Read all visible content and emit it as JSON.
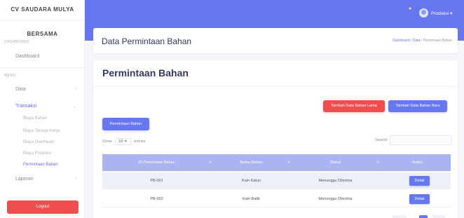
{
  "sidebar": {
    "brand_line1": "CV SAUDARA MULYA",
    "brand_line2": "BERSAMA",
    "section_dashboard": "DASHBOARD",
    "dashboard_label": "Dashboard",
    "section_menu": "MENU",
    "data_label": "Data",
    "transaksi_label": "Transaksi",
    "transaksi_items": [
      "Biaya Bahan",
      "Biaya Tenaga Kerja",
      "Biaya Overhead",
      "Biaya Produksi",
      "Permintaan Bahan"
    ],
    "laporan_label": "Laporan",
    "logout_label": "Logout"
  },
  "topbar": {
    "username": "Produksi ▾"
  },
  "header": {
    "title": "Data Permintaan Bahan",
    "breadcrumb": [
      "Dashboard",
      "Data",
      "Permintaan Bahan"
    ]
  },
  "main": {
    "title": "Permintaan Bahan",
    "btn_tambah_lama": "Tambah Data Bahan Lama",
    "btn_tambah_baru": "Tambah Data Bahan Baru",
    "btn_permintaan": "Permintaan Bahan",
    "show_label": "Show",
    "entries_value": "10 ≑",
    "entries_label": "entries",
    "search_label": "Search:",
    "columns": [
      "ID Permintaan Bahan",
      "Nama Bahan",
      "Status",
      "Action"
    ],
    "rows": [
      {
        "id": "PB-001",
        "nama": "Kain Katun",
        "status": "Menunggu Diterima",
        "action": "Detail"
      },
      {
        "id": "PB-002",
        "nama": "Kain Batik",
        "status": "Menunggu Diterima",
        "action": "Detail"
      }
    ]
  },
  "colors": {
    "primary": "#6777ef",
    "danger": "#ee4e4e",
    "table_header": "#aab4ee"
  },
  "icons": {
    "notification": "bell-icon",
    "avatar": "user-avatar-icon"
  }
}
